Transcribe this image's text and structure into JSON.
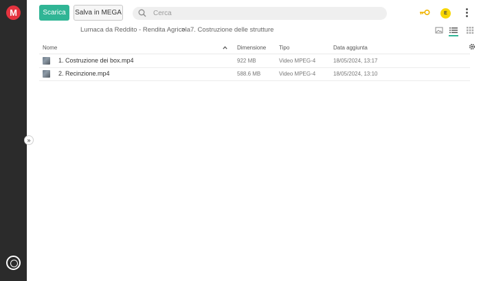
{
  "sidebar": {
    "logo_letter": "M"
  },
  "toolbar": {
    "download_label": "Scarica",
    "save_label": "Salva in MEGA"
  },
  "search": {
    "placeholder": "Cerca"
  },
  "user": {
    "avatar_initial": "E"
  },
  "breadcrumb": {
    "parent": "Lumaca da Reddito - Rendita Agricola",
    "separator": ">",
    "current": "7. Costruzione delle strutture"
  },
  "table": {
    "columns": {
      "name": "Nome",
      "size": "Dimensione",
      "type": "Tipo",
      "date": "Data aggiunta"
    },
    "sort_icon": "chevron-up-icon",
    "rows": [
      {
        "name": "1. Costruzione dei box.mp4",
        "size": "922 MB",
        "type": "Video MPEG-4",
        "date": "18/05/2024, 13:17"
      },
      {
        "name": "2. Recinzione.mp4",
        "size": "588.6 MB",
        "type": "Video MPEG-4",
        "date": "18/05/2024, 13:10"
      }
    ]
  },
  "colors": {
    "accent": "#30b595",
    "sidebar": "#2b2b2b",
    "logo": "#e5333f",
    "avatar": "#f7d600",
    "key": "#f0b400"
  }
}
